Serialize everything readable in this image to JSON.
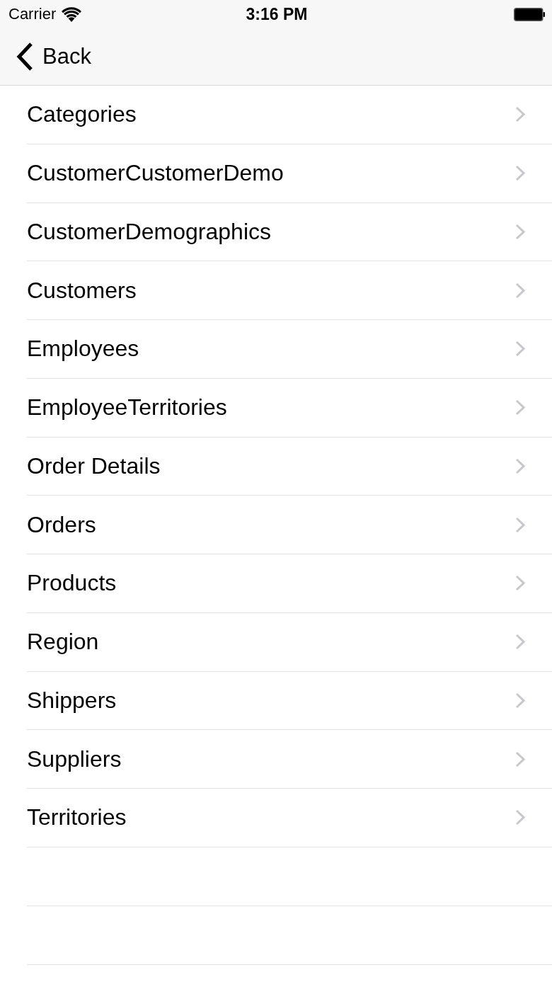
{
  "status_bar": {
    "carrier": "Carrier",
    "time": "3:16 PM"
  },
  "nav_bar": {
    "back_label": "Back"
  },
  "list": {
    "items": [
      {
        "label": "Categories"
      },
      {
        "label": "CustomerCustomerDemo"
      },
      {
        "label": "CustomerDemographics"
      },
      {
        "label": "Customers"
      },
      {
        "label": "Employees"
      },
      {
        "label": "EmployeeTerritories"
      },
      {
        "label": "Order Details"
      },
      {
        "label": "Orders"
      },
      {
        "label": "Products"
      },
      {
        "label": "Region"
      },
      {
        "label": "Shippers"
      },
      {
        "label": "Suppliers"
      },
      {
        "label": "Territories"
      }
    ]
  }
}
